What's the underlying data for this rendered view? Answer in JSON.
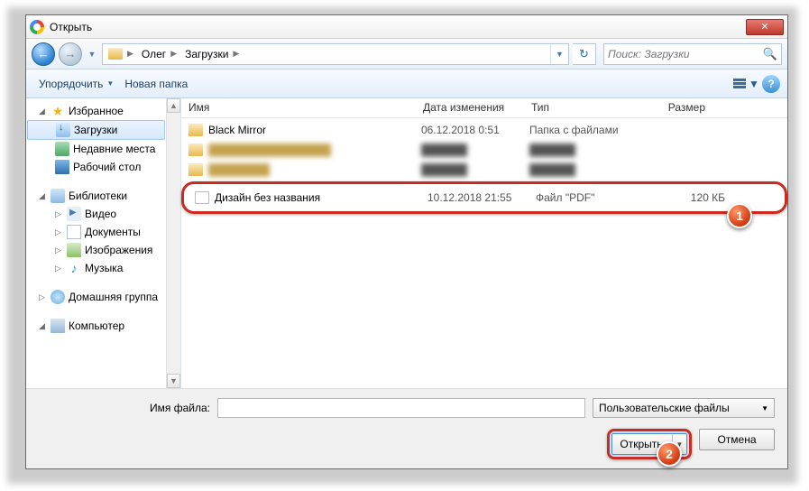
{
  "title": "Открыть",
  "breadcrumb": {
    "user": "Олег",
    "folder": "Загрузки"
  },
  "search_placeholder": "Поиск: Загрузки",
  "toolbar": {
    "organize": "Упорядочить",
    "newfolder": "Новая папка"
  },
  "sidebar": {
    "favorites": "Избранное",
    "downloads": "Загрузки",
    "recent": "Недавние места",
    "desktop": "Рабочий стол",
    "libraries": "Библиотеки",
    "video": "Видео",
    "documents": "Документы",
    "images": "Изображения",
    "music": "Музыка",
    "homegroup": "Домашняя группа",
    "computer": "Компьютер"
  },
  "columns": {
    "name": "Имя",
    "date": "Дата изменения",
    "type": "Тип",
    "size": "Размер"
  },
  "files": {
    "row0": {
      "name": "Black Mirror",
      "date": "06.12.2018 0:51",
      "type": "Папка с файлами",
      "size": ""
    },
    "row3": {
      "name": "Дизайн без названия",
      "date": "10.12.2018 21:55",
      "type": "Файл \"PDF\"",
      "size": "120 КБ"
    }
  },
  "bottom": {
    "filename_label": "Имя файла:",
    "filename_value": "",
    "filter": "Пользовательские файлы",
    "open": "Открыть",
    "cancel": "Отмена"
  },
  "callouts": {
    "one": "1",
    "two": "2"
  }
}
